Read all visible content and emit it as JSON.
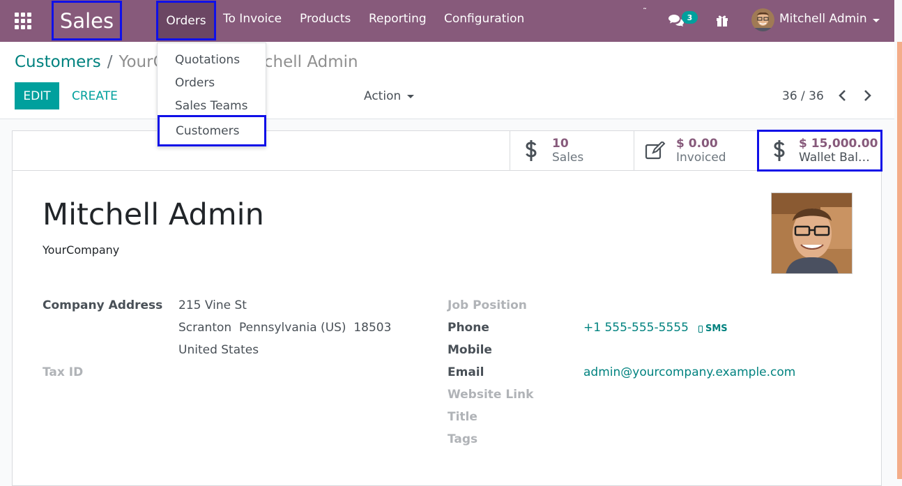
{
  "navbar": {
    "app_name": "Sales",
    "menus": [
      "Orders",
      "To Invoice",
      "Products",
      "Reporting",
      "Configuration"
    ],
    "tilde": "˜",
    "chat_count": "3",
    "user_name": "Mitchell Admin"
  },
  "breadcrumb": {
    "parent": "Customers",
    "separator": "/",
    "current": "YourCompany, Mitchell Admin"
  },
  "toolbar": {
    "edit_label": "EDIT",
    "create_label": "CREATE",
    "action_label": "Action",
    "pager": "36 / 36"
  },
  "stat_buttons": [
    {
      "value": "10",
      "label": "Sales",
      "icon": "dollar-icon"
    },
    {
      "value": "$ 0.00",
      "label": "Invoiced",
      "icon": "pencil-square-icon"
    },
    {
      "value": "$ 15,000.00",
      "label": "Wallet Bal…",
      "icon": "dollar-icon"
    }
  ],
  "partner": {
    "name": "Mitchell Admin",
    "company": "YourCompany"
  },
  "left_fields": {
    "company_address_label": "Company Address",
    "address_line1": "215 Vine St",
    "address_line2": "Scranton  Pennsylvania (US)  18503",
    "address_line3": "United States",
    "tax_id_label": "Tax ID"
  },
  "right_fields": {
    "job_position_label": "Job Position",
    "phone_label": "Phone",
    "phone_value": "+1 555-555-5555",
    "sms_label": "SMS",
    "mobile_label": "Mobile",
    "email_label": "Email",
    "email_value": "admin@yourcompany.example.com",
    "website_label": "Website Link",
    "title_label": "Title",
    "tags_label": "Tags"
  },
  "orders_dropdown": [
    "Quotations",
    "Orders",
    "Sales Teams",
    "Customers"
  ],
  "colors": {
    "navbar": "#875a7b",
    "accent": "#00a09d",
    "highlight_outline": "#1010e8"
  }
}
